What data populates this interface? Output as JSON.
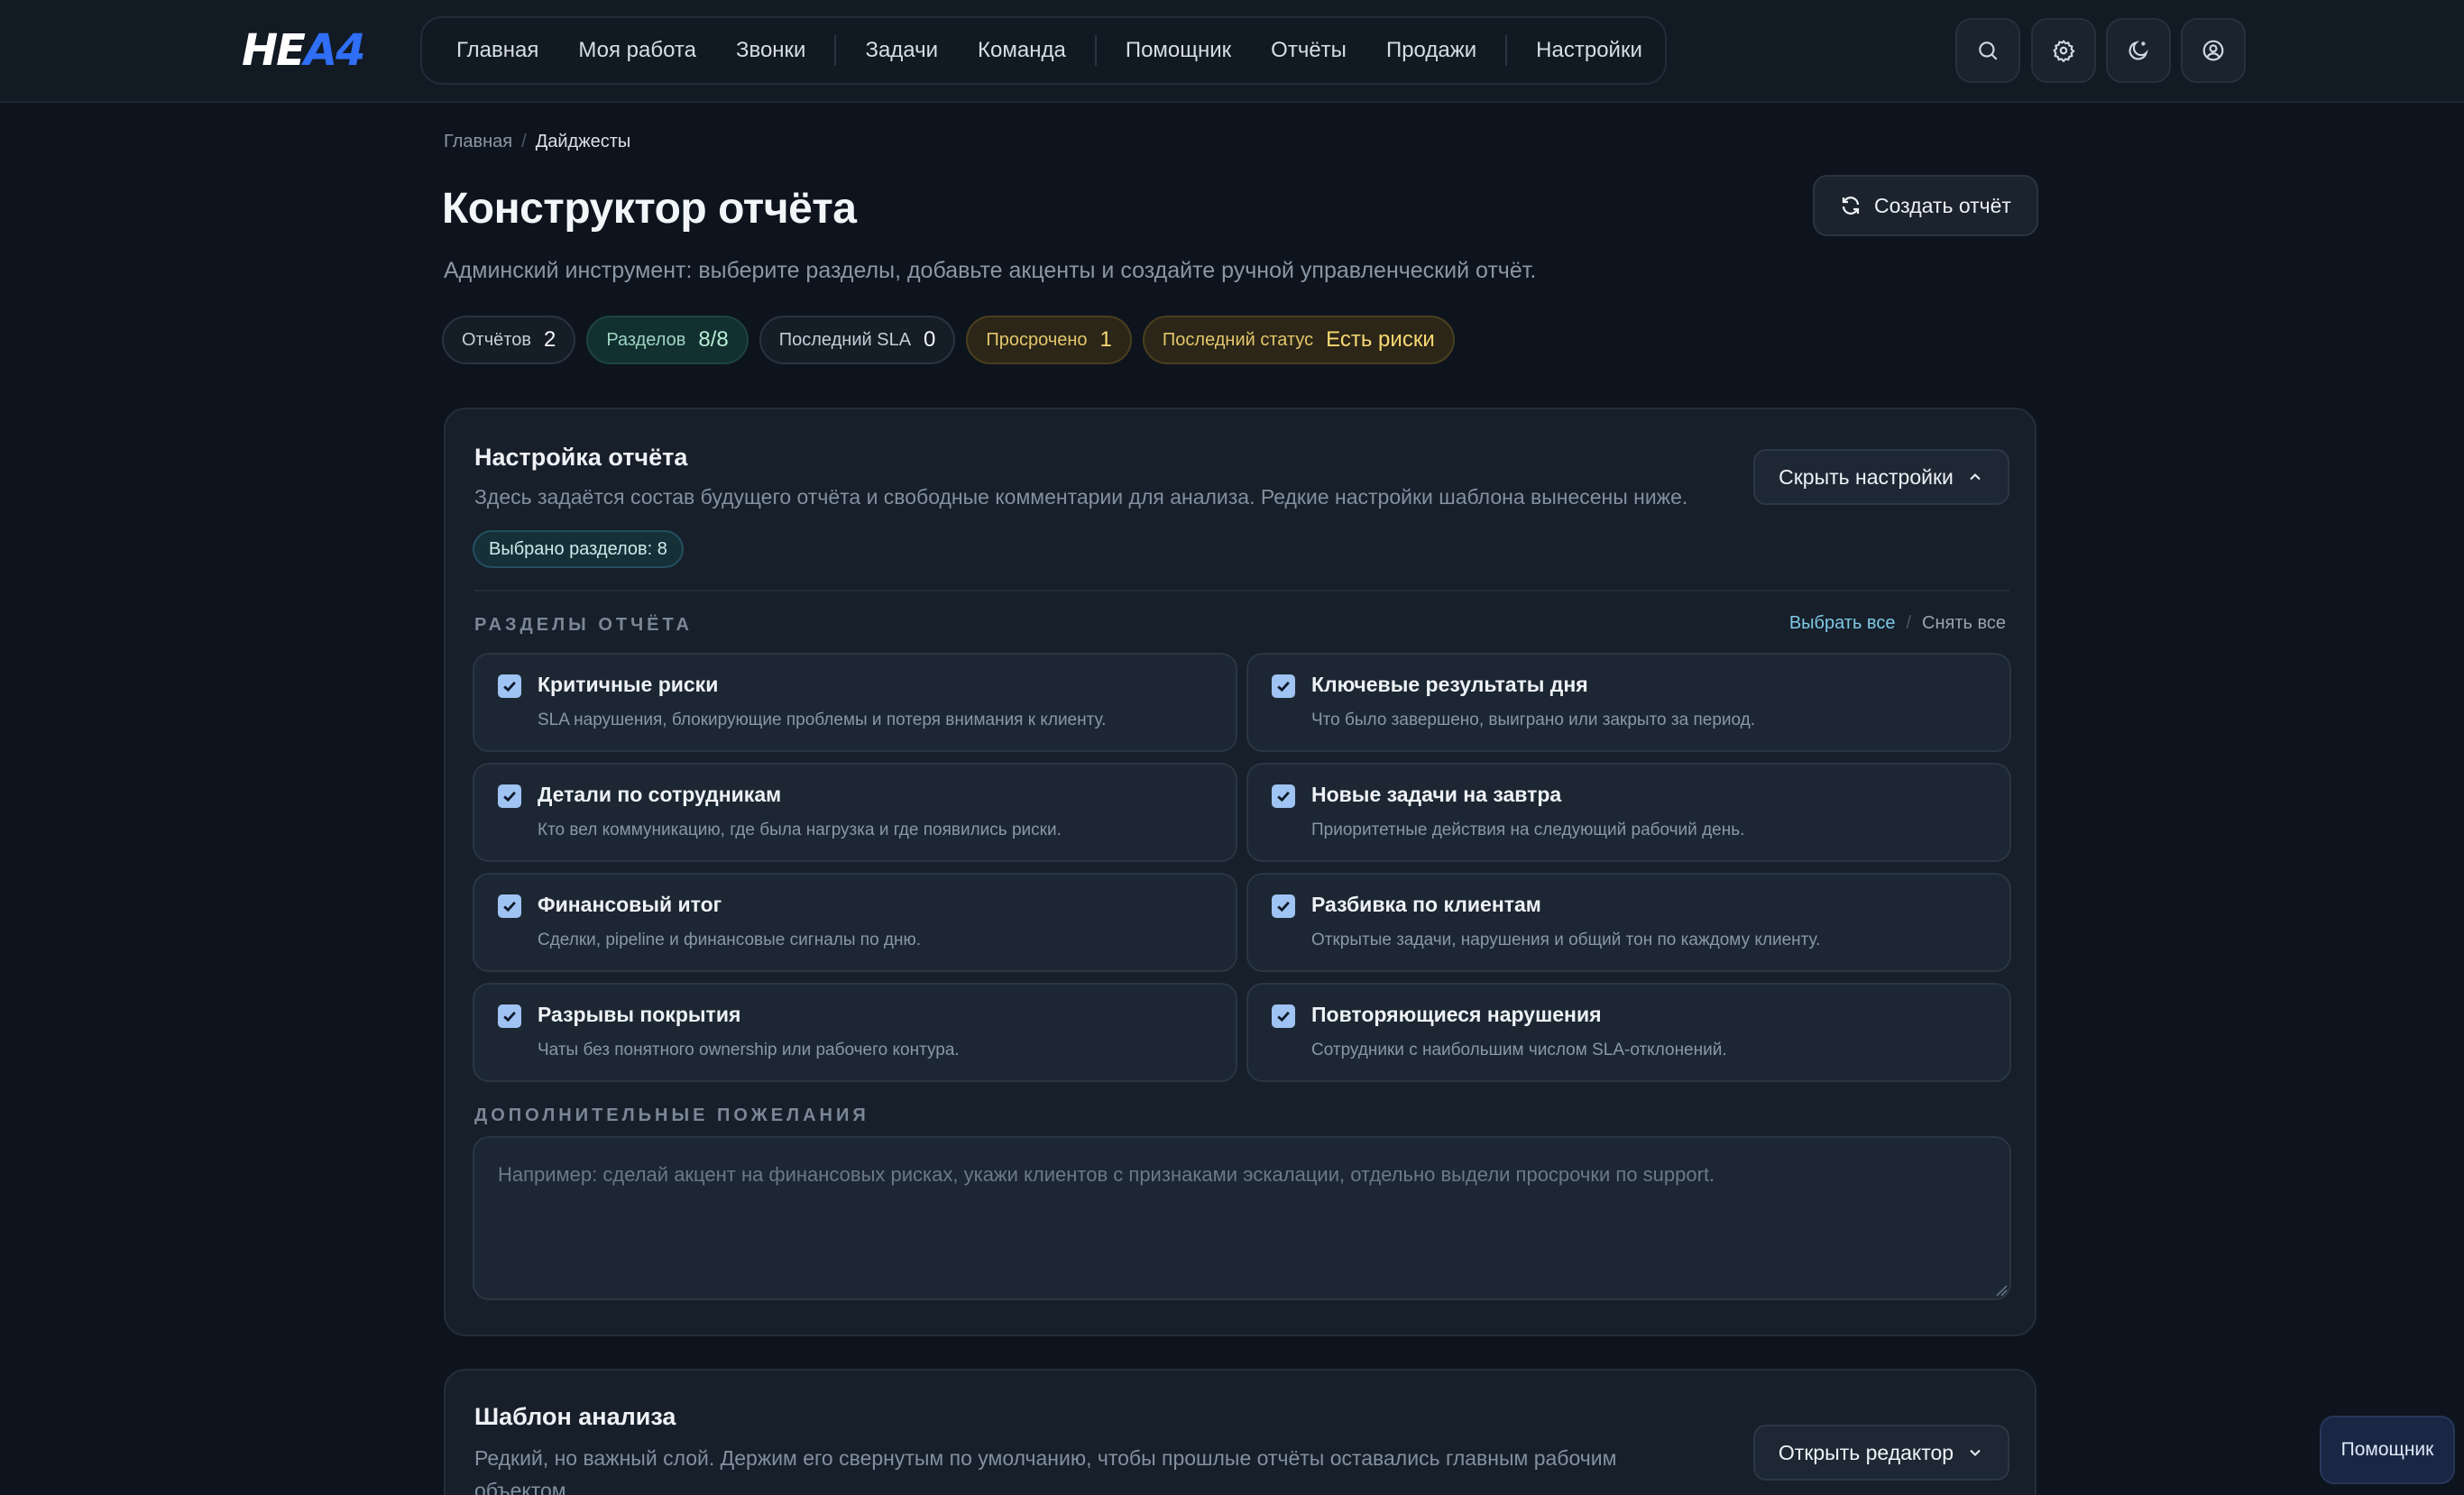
{
  "brand": {
    "logo_part1": "НЕ",
    "logo_part2": "А4"
  },
  "nav": {
    "items": [
      "Главная",
      "Моя работа",
      "Звонки",
      "Задачи",
      "Команда",
      "Помощник",
      "Отчёты",
      "Продажи",
      "Настройки"
    ]
  },
  "header_icons": [
    "search-icon",
    "gear-icon",
    "theme-moon-icon",
    "user-circle-icon"
  ],
  "breadcrumb": {
    "home": "Главная",
    "separator": "/",
    "current": "Дайджесты"
  },
  "page": {
    "title": "Конструктор отчёта",
    "description": "Админский инструмент: выберите разделы, добавьте акценты и создайте ручной управленческий отчёт.",
    "create_button": "Создать отчёт"
  },
  "stats": [
    {
      "label": "Отчётов",
      "value": "2"
    },
    {
      "label": "Разделов",
      "value": "8/8"
    },
    {
      "label": "Последний SLA",
      "value": "0"
    },
    {
      "label": "Просрочено",
      "value": "1"
    },
    {
      "label": "Последний статус",
      "value": "Есть риски"
    }
  ],
  "settings": {
    "title": "Настройка отчёта",
    "subtitle": "Здесь задаётся состав будущего отчёта и свободные комментарии для анализа. Редкие настройки шаблона вынесены ниже.",
    "hide_button": "Скрыть настройки",
    "selected_badge": "Выбрано разделов: 8",
    "sections_label": "РАЗДЕЛЫ ОТЧЁТА",
    "select_all": "Выбрать все",
    "links_separator": "/",
    "clear_all": "Снять все",
    "options": [
      {
        "title": "Критичные риски",
        "desc": "SLA нарушения, блокирующие проблемы и потеря внимания к клиенту.",
        "checked": true
      },
      {
        "title": "Ключевые результаты дня",
        "desc": "Что было завершено, выиграно или закрыто за период.",
        "checked": true
      },
      {
        "title": "Детали по сотрудникам",
        "desc": "Кто вел коммуникацию, где была нагрузка и где появились риски.",
        "checked": true
      },
      {
        "title": "Новые задачи на завтра",
        "desc": "Приоритетные действия на следующий рабочий день.",
        "checked": true
      },
      {
        "title": "Финансовый итог",
        "desc": "Сделки, pipeline и финансовые сигналы по дню.",
        "checked": true
      },
      {
        "title": "Разбивка по клиентам",
        "desc": "Открытые задачи, нарушения и общий тон по каждому клиенту.",
        "checked": true
      },
      {
        "title": "Разрывы покрытия",
        "desc": "Чаты без понятного ownership или рабочего контура.",
        "checked": true
      },
      {
        "title": "Повторяющиеся нарушения",
        "desc": "Сотрудники с наибольшим числом SLA-отклонений.",
        "checked": true
      }
    ],
    "wishes_label": "ДОПОЛНИТЕЛЬНЫЕ ПОЖЕЛАНИЯ",
    "wishes_placeholder": "Например: сделай акцент на финансовых рисках, укажи клиентов с признаками эскалации, отдельно выдели просрочки по support.",
    "wishes_value": ""
  },
  "template": {
    "title": "Шаблон анализа",
    "subtitle_line1": "Редкий, но важный слой. Держим его свернутым по умолчанию, чтобы прошлые отчёты оставались главным рабочим",
    "subtitle_line2": "объектом.",
    "open_button": "Открыть редактор"
  },
  "assistant_button": "Помощник",
  "colors": {
    "accent": "#2f6ef5",
    "background": "#0d141d",
    "card": "#161f2a",
    "checkbox": "#9fc3f2"
  }
}
